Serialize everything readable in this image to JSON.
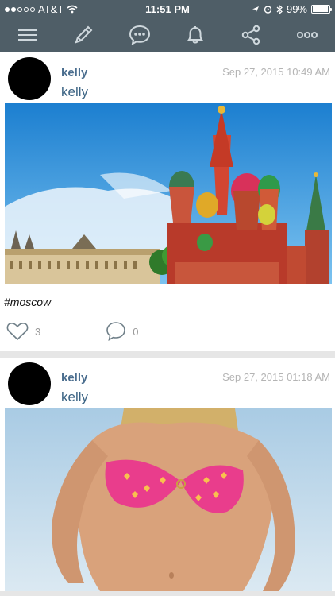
{
  "status": {
    "carrier": "AT&T",
    "time": "11:51 PM",
    "battery": "99%",
    "battery_level": 0.99
  },
  "toolbar": {
    "icons": [
      "menu-icon",
      "pencil-icon",
      "chat-bubble-icon",
      "bell-icon",
      "share-icon",
      "more-icon"
    ]
  },
  "posts": [
    {
      "username": "kelly",
      "display_name": "kelly",
      "timestamp": "Sep 27, 2015 10:49 AM",
      "caption": "#moscow",
      "likes": "3",
      "comments": "0",
      "image": "St. Basil's Cathedral, Moscow"
    },
    {
      "username": "kelly",
      "display_name": "kelly",
      "timestamp": "Sep 27, 2015 01:18 AM",
      "caption": "",
      "likes": "",
      "comments": "",
      "image": "swimsuit photo"
    }
  ],
  "colors": {
    "toolbar_bg": "#4f5e67",
    "username": "#4a6d8e",
    "timestamp": "#b4b4b4"
  }
}
